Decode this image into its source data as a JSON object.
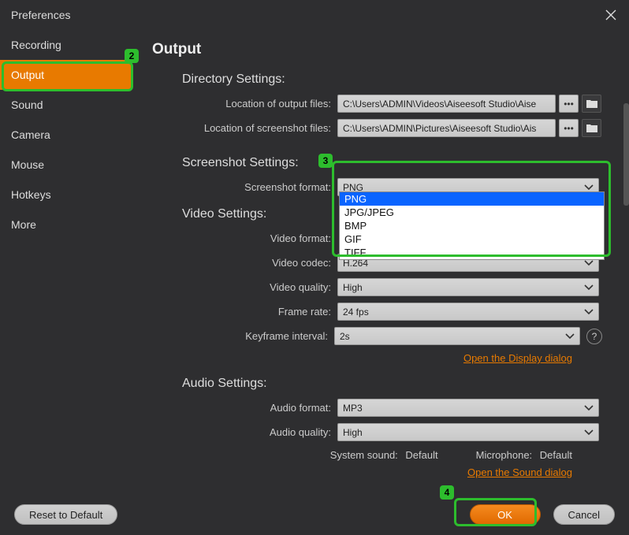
{
  "window": {
    "title": "Preferences"
  },
  "sidebar": {
    "items": [
      {
        "label": "Recording"
      },
      {
        "label": "Output"
      },
      {
        "label": "Sound"
      },
      {
        "label": "Camera"
      },
      {
        "label": "Mouse"
      },
      {
        "label": "Hotkeys"
      },
      {
        "label": "More"
      }
    ],
    "active_index": 1
  },
  "main": {
    "title": "Output",
    "directory": {
      "title": "Directory Settings:",
      "output_label": "Location of output files:",
      "output_value": "C:\\Users\\ADMIN\\Videos\\Aiseesoft Studio\\Aise",
      "screenshot_label": "Location of screenshot files:",
      "screenshot_value": "C:\\Users\\ADMIN\\Pictures\\Aiseesoft Studio\\Ais"
    },
    "screenshot": {
      "title": "Screenshot Settings:",
      "format_label": "Screenshot format:",
      "format_value": "PNG",
      "options": [
        "PNG",
        "JPG/JPEG",
        "BMP",
        "GIF",
        "TIFF"
      ]
    },
    "video": {
      "title": "Video Settings:",
      "format_label": "Video format:",
      "codec_label": "Video codec:",
      "codec_value": "H.264",
      "quality_label": "Video quality:",
      "quality_value": "High",
      "fps_label": "Frame rate:",
      "fps_value": "24 fps",
      "keyframe_label": "Keyframe interval:",
      "keyframe_value": "2s",
      "link": "Open the Display dialog"
    },
    "audio": {
      "title": "Audio Settings:",
      "format_label": "Audio format:",
      "format_value": "MP3",
      "quality_label": "Audio quality:",
      "quality_value": "High",
      "system_label": "System sound:",
      "system_value": "Default",
      "mic_label": "Microphone:",
      "mic_value": "Default",
      "link": "Open the Sound dialog"
    }
  },
  "bottom": {
    "reset": "Reset to Default",
    "ok": "OK",
    "cancel": "Cancel"
  },
  "annotations": {
    "a2": "2",
    "a3": "3",
    "a4": "4"
  }
}
